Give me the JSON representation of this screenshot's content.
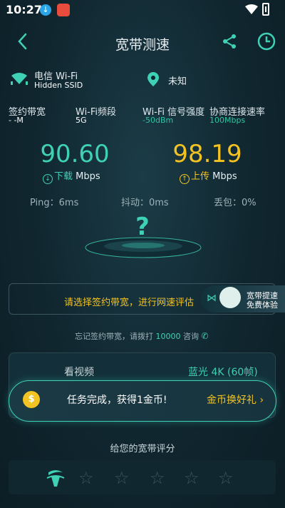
{
  "status_bar": {
    "time": "10:27"
  },
  "header": {
    "title": "宽带测速"
  },
  "network": {
    "ssid_name": "电信 Wi-Fi",
    "ssid_sub": "Hidden SSID",
    "location": "未知"
  },
  "stats": [
    {
      "label": "签约带宽",
      "value": "- -M"
    },
    {
      "label": "Wi-Fi频段",
      "value": "5G"
    },
    {
      "label": "Wi-Fi 信号强度",
      "value": "-50dBm"
    },
    {
      "label": "协商连接速率",
      "value": "100Mbps"
    }
  ],
  "speed": {
    "download_value": "90.60",
    "download_word": "下载",
    "upload_value": "98.19",
    "upload_word": "上传",
    "unit": "Mbps"
  },
  "metrics": {
    "ping": "Ping：6ms",
    "jitter": "抖动：0ms",
    "loss": "丢包：0%"
  },
  "question_mark": "?",
  "prompt": {
    "text": "请选择签约带宽，进行网速评估"
  },
  "promo": {
    "line1": "宽带提速",
    "line2": "免费体验"
  },
  "forgot": {
    "text": "忘记签约带宽，请拨打",
    "number": "10000",
    "suffix": "咨询"
  },
  "video": {
    "label": "看视频",
    "value": "蓝光 4K (60帧)"
  },
  "toast": {
    "coin": "$",
    "message": "任务完成，获得1金币!",
    "link": "金币换好礼"
  },
  "rating": {
    "label": "给您的宽带评分",
    "stars": 5
  },
  "colors": {
    "accent": "#3fd1b5",
    "highlight": "#f3c322",
    "background": "#10262f"
  }
}
